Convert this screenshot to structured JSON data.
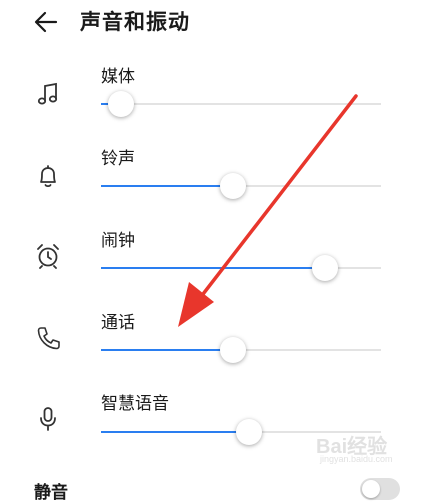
{
  "header": {
    "title": "声音和振动"
  },
  "sliders": [
    {
      "label": "媒体",
      "icon": "music-note-icon",
      "level": 0.07
    },
    {
      "label": "铃声",
      "icon": "bell-icon",
      "level": 0.47
    },
    {
      "label": "闹钟",
      "icon": "alarm-clock-icon",
      "level": 0.8
    },
    {
      "label": "通话",
      "icon": "phone-icon",
      "level": 0.47
    },
    {
      "label": "智慧语音",
      "icon": "microphone-icon",
      "level": 0.53
    }
  ],
  "mute": {
    "label": "静音"
  },
  "colors": {
    "accent": "#2a7ef0",
    "arrow": "#e8362c",
    "track": "#e3e3e3"
  },
  "watermark": {
    "brand": "Bai经验",
    "url": "jingyan.baidu.com"
  }
}
